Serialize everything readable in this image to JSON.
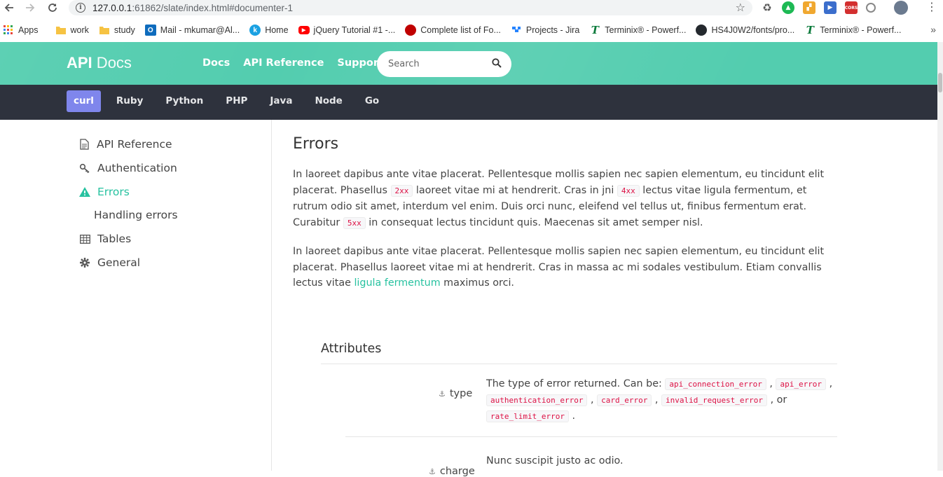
{
  "browser": {
    "url_host": "127.0.0.1",
    "url_rest": ":61862/slate/index.html#documenter-1",
    "bookmarks": [
      {
        "label": "Apps",
        "icon": "apps-grid-icon",
        "color": "#e8453c"
      },
      {
        "label": "work",
        "icon": "folder-icon",
        "color": "#f6c343"
      },
      {
        "label": "study",
        "icon": "folder-icon",
        "color": "#f6c343"
      },
      {
        "label": "Mail - mkumar@Al...",
        "icon": "outlook-icon",
        "color": "#0f6cbd"
      },
      {
        "label": "Home",
        "icon": "k-icon",
        "color": "#1ba1e2"
      },
      {
        "label": "jQuery Tutorial #1 -...",
        "icon": "youtube-icon",
        "color": "#ff0000"
      },
      {
        "label": "Complete list of Fo...",
        "icon": "red-circle-icon",
        "color": "#c00000"
      },
      {
        "label": "Projects - Jira",
        "icon": "jira-icon",
        "color": "#2684ff"
      },
      {
        "label": "Terminix® - Powerf...",
        "icon": "terminix-icon",
        "color": "#0a7a3b"
      },
      {
        "label": "HS4J0W2/fonts/pro...",
        "icon": "github-icon",
        "color": "#24292e"
      },
      {
        "label": "Terminix® - Powerf...",
        "icon": "terminix-icon",
        "color": "#0a7a3b"
      }
    ]
  },
  "header": {
    "logo_bold": "API",
    "logo_light": " Docs",
    "nav": [
      "Docs",
      "API Reference",
      "Support"
    ],
    "search_placeholder": "Search",
    "accent": "#53cdaf"
  },
  "languages": {
    "tabs": [
      "curl",
      "Ruby",
      "Python",
      "PHP",
      "Java",
      "Node",
      "Go"
    ],
    "active": "curl",
    "active_color": "#7f86ec"
  },
  "sidebar": {
    "items": [
      {
        "label": "API Reference",
        "icon": "document-icon"
      },
      {
        "label": "Authentication",
        "icon": "key-icon"
      },
      {
        "label": "Errors",
        "icon": "warning-icon"
      },
      {
        "label": "Handling errors",
        "icon": ""
      },
      {
        "label": "Tables",
        "icon": "table-icon"
      },
      {
        "label": "General",
        "icon": "gear-icon"
      }
    ],
    "active": "Errors"
  },
  "main": {
    "title": "Errors",
    "p1": {
      "t1": "In laoreet dapibus ante vitae placerat. Pellentesque mollis sapien nec sapien elementum, eu tincidunt elit placerat. Phasellus ",
      "c1": "2xx",
      "t2": " laoreet vitae mi at hendrerit. Cras in jni ",
      "c2": "4xx",
      "t3": " lectus vitae ligula fermentum, et rutrum odio sit amet, interdum vel enim. Duis orci nunc, eleifend vel tellus ut, finibus fermentum erat. Curabitur ",
      "c3": "5xx",
      "t4": " in consequat lectus tincidunt quis. Maecenas sit amet semper nisl."
    },
    "p2": {
      "t1": "In laoreet dapibus ante vitae placerat. Pellentesque mollis sapien nec sapien elementum, eu tincidunt elit placerat. Phasellus laoreet vitae mi at hendrerit. Cras in massa ac mi sodales vestibulum. Etiam convallis lectus vitae ",
      "link": "ligula fermentum",
      "t2": " maximus orci."
    },
    "attributes_title": "Attributes",
    "attributes": [
      {
        "name": "type",
        "desc_prefix": "The type of error returned. Can be: ",
        "codes": [
          "api_connection_error",
          "api_error",
          "authentication_error",
          "card_error",
          "invalid_request_error",
          "rate_limit_error"
        ],
        "sep1": " , ",
        "sep2": " , ",
        "sep3": " , ",
        "sep4": " , ",
        "sep5": " , or ",
        "end": " ."
      },
      {
        "name": "charge",
        "desc": "Nunc suscipit justo ac odio."
      }
    ]
  }
}
